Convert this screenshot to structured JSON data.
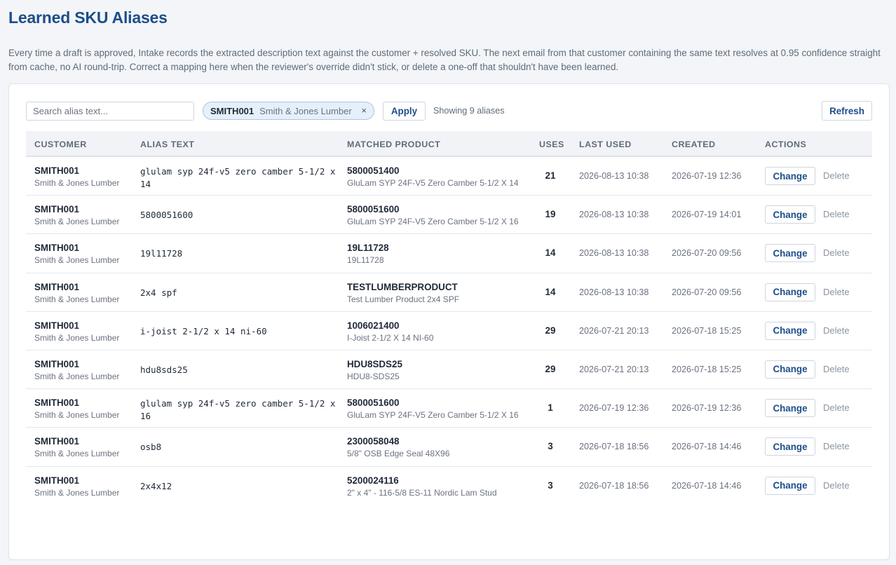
{
  "page": {
    "title": "Learned SKU Aliases",
    "intro": "Every time a draft is approved, Intake records the extracted description text against the customer + resolved SKU. The next email from that customer containing the same text resolves at 0.95 confidence straight from cache, no AI round-trip. Correct a mapping here when the reviewer's override didn't stick, or delete a one-off that shouldn't have been learned."
  },
  "toolbar": {
    "search_placeholder": "Search alias text...",
    "search_value": "",
    "filter_chip": {
      "code": "SMITH001",
      "name": "Smith & Jones Lumber",
      "close_glyph": "×"
    },
    "apply_label": "Apply",
    "count_text": "Showing 9 aliases",
    "refresh_label": "Refresh"
  },
  "table": {
    "headers": {
      "customer": "CUSTOMER",
      "alias_text": "ALIAS TEXT",
      "matched_product": "MATCHED PRODUCT",
      "uses": "USES",
      "last_used": "LAST USED",
      "created": "CREATED",
      "actions": "ACTIONS"
    },
    "change_label": "Change",
    "delete_label": "Delete",
    "rows": [
      {
        "customer_code": "SMITH001",
        "customer_name": "Smith & Jones Lumber",
        "alias": "glulam syp 24f-v5 zero camber 5-1/2 x 14",
        "sku": "5800051400",
        "product_desc": "GluLam SYP 24F-V5 Zero Camber 5-1/2 X 14",
        "uses": "21",
        "last_used": "2026-08-13 10:38",
        "created": "2026-07-19 12:36"
      },
      {
        "customer_code": "SMITH001",
        "customer_name": "Smith & Jones Lumber",
        "alias": "5800051600",
        "sku": "5800051600",
        "product_desc": "GluLam SYP 24F-V5 Zero Camber 5-1/2 X 16",
        "uses": "19",
        "last_used": "2026-08-13 10:38",
        "created": "2026-07-19 14:01"
      },
      {
        "customer_code": "SMITH001",
        "customer_name": "Smith & Jones Lumber",
        "alias": "19l11728",
        "sku": "19L11728",
        "product_desc": "19L11728",
        "uses": "14",
        "last_used": "2026-08-13 10:38",
        "created": "2026-07-20 09:56"
      },
      {
        "customer_code": "SMITH001",
        "customer_name": "Smith & Jones Lumber",
        "alias": "2x4 spf",
        "sku": "TESTLUMBERPRODUCT",
        "product_desc": "Test Lumber Product 2x4 SPF",
        "uses": "14",
        "last_used": "2026-08-13 10:38",
        "created": "2026-07-20 09:56"
      },
      {
        "customer_code": "SMITH001",
        "customer_name": "Smith & Jones Lumber",
        "alias": "i-joist 2-1/2 x 14 ni-60",
        "sku": "1006021400",
        "product_desc": "I-Joist 2-1/2 X 14 NI-60",
        "uses": "29",
        "last_used": "2026-07-21 20:13",
        "created": "2026-07-18 15:25"
      },
      {
        "customer_code": "SMITH001",
        "customer_name": "Smith & Jones Lumber",
        "alias": "hdu8sds25",
        "sku": "HDU8SDS25",
        "product_desc": "HDU8-SDS25",
        "uses": "29",
        "last_used": "2026-07-21 20:13",
        "created": "2026-07-18 15:25"
      },
      {
        "customer_code": "SMITH001",
        "customer_name": "Smith & Jones Lumber",
        "alias": "glulam syp 24f-v5 zero camber 5-1/2 x 16",
        "sku": "5800051600",
        "product_desc": "GluLam SYP 24F-V5 Zero Camber 5-1/2 X 16",
        "uses": "1",
        "last_used": "2026-07-19 12:36",
        "created": "2026-07-19 12:36"
      },
      {
        "customer_code": "SMITH001",
        "customer_name": "Smith & Jones Lumber",
        "alias": "osb8",
        "sku": "2300058048",
        "product_desc": "5/8\" OSB Edge Seal 48X96",
        "uses": "3",
        "last_used": "2026-07-18 18:56",
        "created": "2026-07-18 14:46"
      },
      {
        "customer_code": "SMITH001",
        "customer_name": "Smith & Jones Lumber",
        "alias": "2x4x12",
        "sku": "5200024116",
        "product_desc": "2\" x 4\" - 116-5/8 ES-11 Nordic Lam Stud",
        "uses": "3",
        "last_used": "2026-07-18 18:56",
        "created": "2026-07-18 14:46"
      }
    ]
  }
}
